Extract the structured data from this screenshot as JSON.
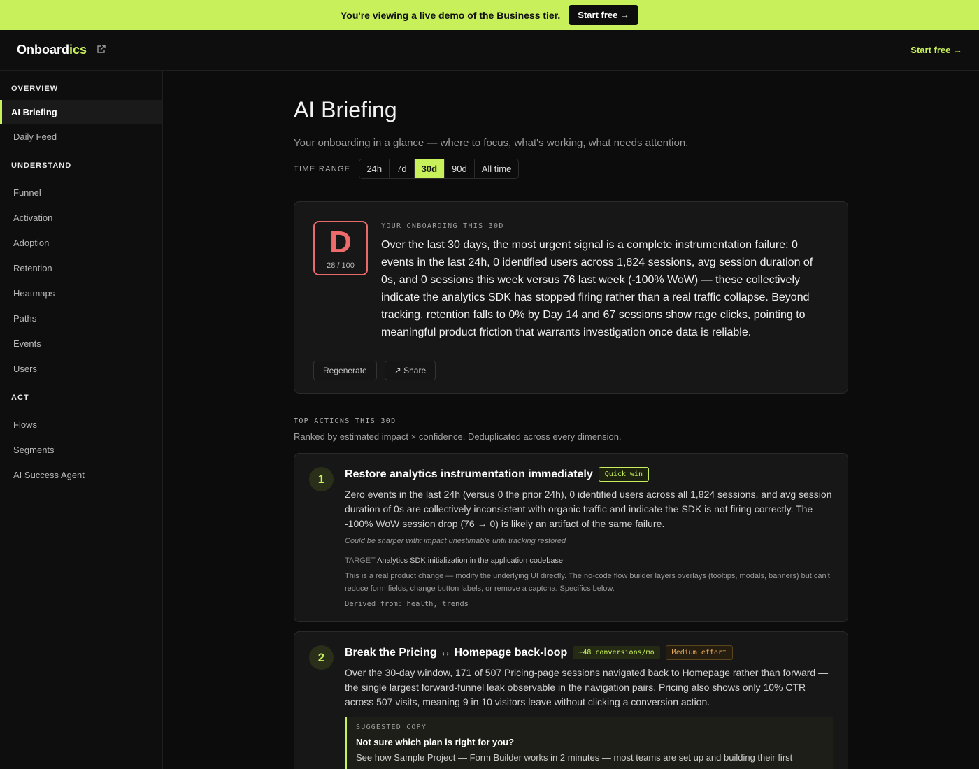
{
  "banner": {
    "text": "You're viewing a live demo of the Business tier.",
    "cta": "Start free →"
  },
  "topbar": {
    "logo_main": "Onboard",
    "logo_accent": "ics",
    "start_free": "Start free →"
  },
  "sidebar": {
    "overview_label": "OVERVIEW",
    "overview_items": [
      "AI Briefing",
      "Daily Feed"
    ],
    "understand_label": "UNDERSTAND",
    "understand_items": [
      "Funnel",
      "Activation",
      "Adoption",
      "Retention",
      "Heatmaps",
      "Paths",
      "Events",
      "Users"
    ],
    "act_label": "ACT",
    "act_items": [
      "Flows",
      "Segments",
      "AI Success Agent"
    ]
  },
  "main": {
    "title": "AI Briefing",
    "subtitle": "Your onboarding in a glance — where to focus, what's working, what needs attention.",
    "time_range_label": "TIME RANGE",
    "time_ranges": [
      "24h",
      "7d",
      "30d",
      "90d",
      "All time"
    ],
    "selected_range": "30d"
  },
  "score": {
    "grade": "D",
    "score_text": "28 / 100",
    "label": "YOUR ONBOARDING THIS 30D",
    "text": "Over the last 30 days, the most urgent signal is a complete instrumentation failure: 0 events in the last 24h, 0 identified users across 1,824 sessions, avg session duration of 0s, and 0 sessions this week versus 76 last week (-100% WoW) — these collectively indicate the analytics SDK has stopped firing rather than a real traffic collapse. Beyond tracking, retention falls to 0% by Day 14 and 67 sessions show rage clicks, pointing to meaningful product friction that warrants investigation once data is reliable.",
    "regenerate": "Regenerate",
    "share": "↗ Share"
  },
  "actions": {
    "label": "TOP ACTIONS THIS 30D",
    "sub": "Ranked by estimated impact × confidence. Deduplicated across every dimension.",
    "items": [
      {
        "num": "1",
        "title": "Restore analytics instrumentation immediately",
        "tag": "Quick win",
        "text": "Zero events in the last 24h (versus 0 the prior 24h), 0 identified users across all 1,824 sessions, and avg session duration of 0s are collectively inconsistent with organic traffic and indicate the SDK is not firing correctly. The -100% WoW session drop (76 → 0) is likely an artifact of the same failure.",
        "hint": "Could be sharper with: impact unestimable until tracking restored",
        "target_label": "TARGET",
        "target": "Analytics SDK initialization in the application codebase",
        "note": "This is a real product change — modify the underlying UI directly. The no-code flow builder layers overlays (tooltips, modals, banners) but can't reduce form fields, change button labels, or remove a captcha. Specifics below.",
        "derived": "Derived from: health, trends"
      },
      {
        "num": "2",
        "title": "Break the Pricing ↔ Homepage back-loop",
        "tag1": "~48 conversions/mo",
        "tag2": "Medium effort",
        "text": "Over the 30-day window, 171 of 507 Pricing-page sessions navigated back to Homepage rather than forward — the single largest forward-funnel leak observable in the navigation pairs. Pricing also shows only 10% CTR across 507 visits, meaning 9 in 10 visitors leave without clicking a conversion action.",
        "suggest_label": "SUGGESTED COPY",
        "suggest_head": "Not sure which plan is right for you?",
        "suggest_body": "See how Sample Project — Form Builder works in 2 minutes — most teams are set up and building their first"
      }
    ]
  }
}
